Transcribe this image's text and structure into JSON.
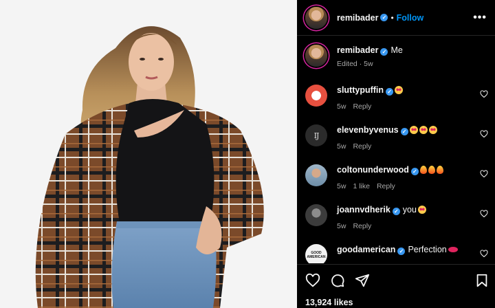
{
  "post": {
    "author": "remibader",
    "follow_label": "Follow",
    "separator": "•",
    "caption": "Me",
    "caption_meta": "Edited · 5w",
    "likes": "13,924 likes"
  },
  "comments": [
    {
      "user": "sluttypuffin",
      "text": "",
      "emojis": [
        "heart-eyes"
      ],
      "meta": [
        "5w",
        "Reply"
      ]
    },
    {
      "user": "elevenbyvenus",
      "text": "",
      "emojis": [
        "heart-eyes",
        "heart-eyes",
        "heart-eyes"
      ],
      "meta": [
        "5w",
        "Reply"
      ]
    },
    {
      "user": "coltonunderwood",
      "text": "",
      "emojis": [
        "fire",
        "fire",
        "fire"
      ],
      "meta": [
        "5w",
        "1 like",
        "Reply"
      ]
    },
    {
      "user": "joannvdherik",
      "text": "you",
      "emojis": [
        "heart-eyes"
      ],
      "meta": [
        "5w",
        "Reply"
      ]
    },
    {
      "user": "goodamerican",
      "text": "Perfection",
      "emojis": [
        "lips"
      ],
      "meta": []
    }
  ],
  "avatar_labels": {
    "elevenbyvenus": "IJ",
    "goodamerican": "GOOD AMERICAN"
  },
  "colors": {
    "follow": "#0095f6",
    "verified": "#3897f0",
    "background": "#000000",
    "muted": "#a8a8a8"
  },
  "icons": [
    "more-options-icon",
    "heart-icon",
    "comment-icon",
    "share-icon",
    "bookmark-icon",
    "verified-badge-icon"
  ]
}
